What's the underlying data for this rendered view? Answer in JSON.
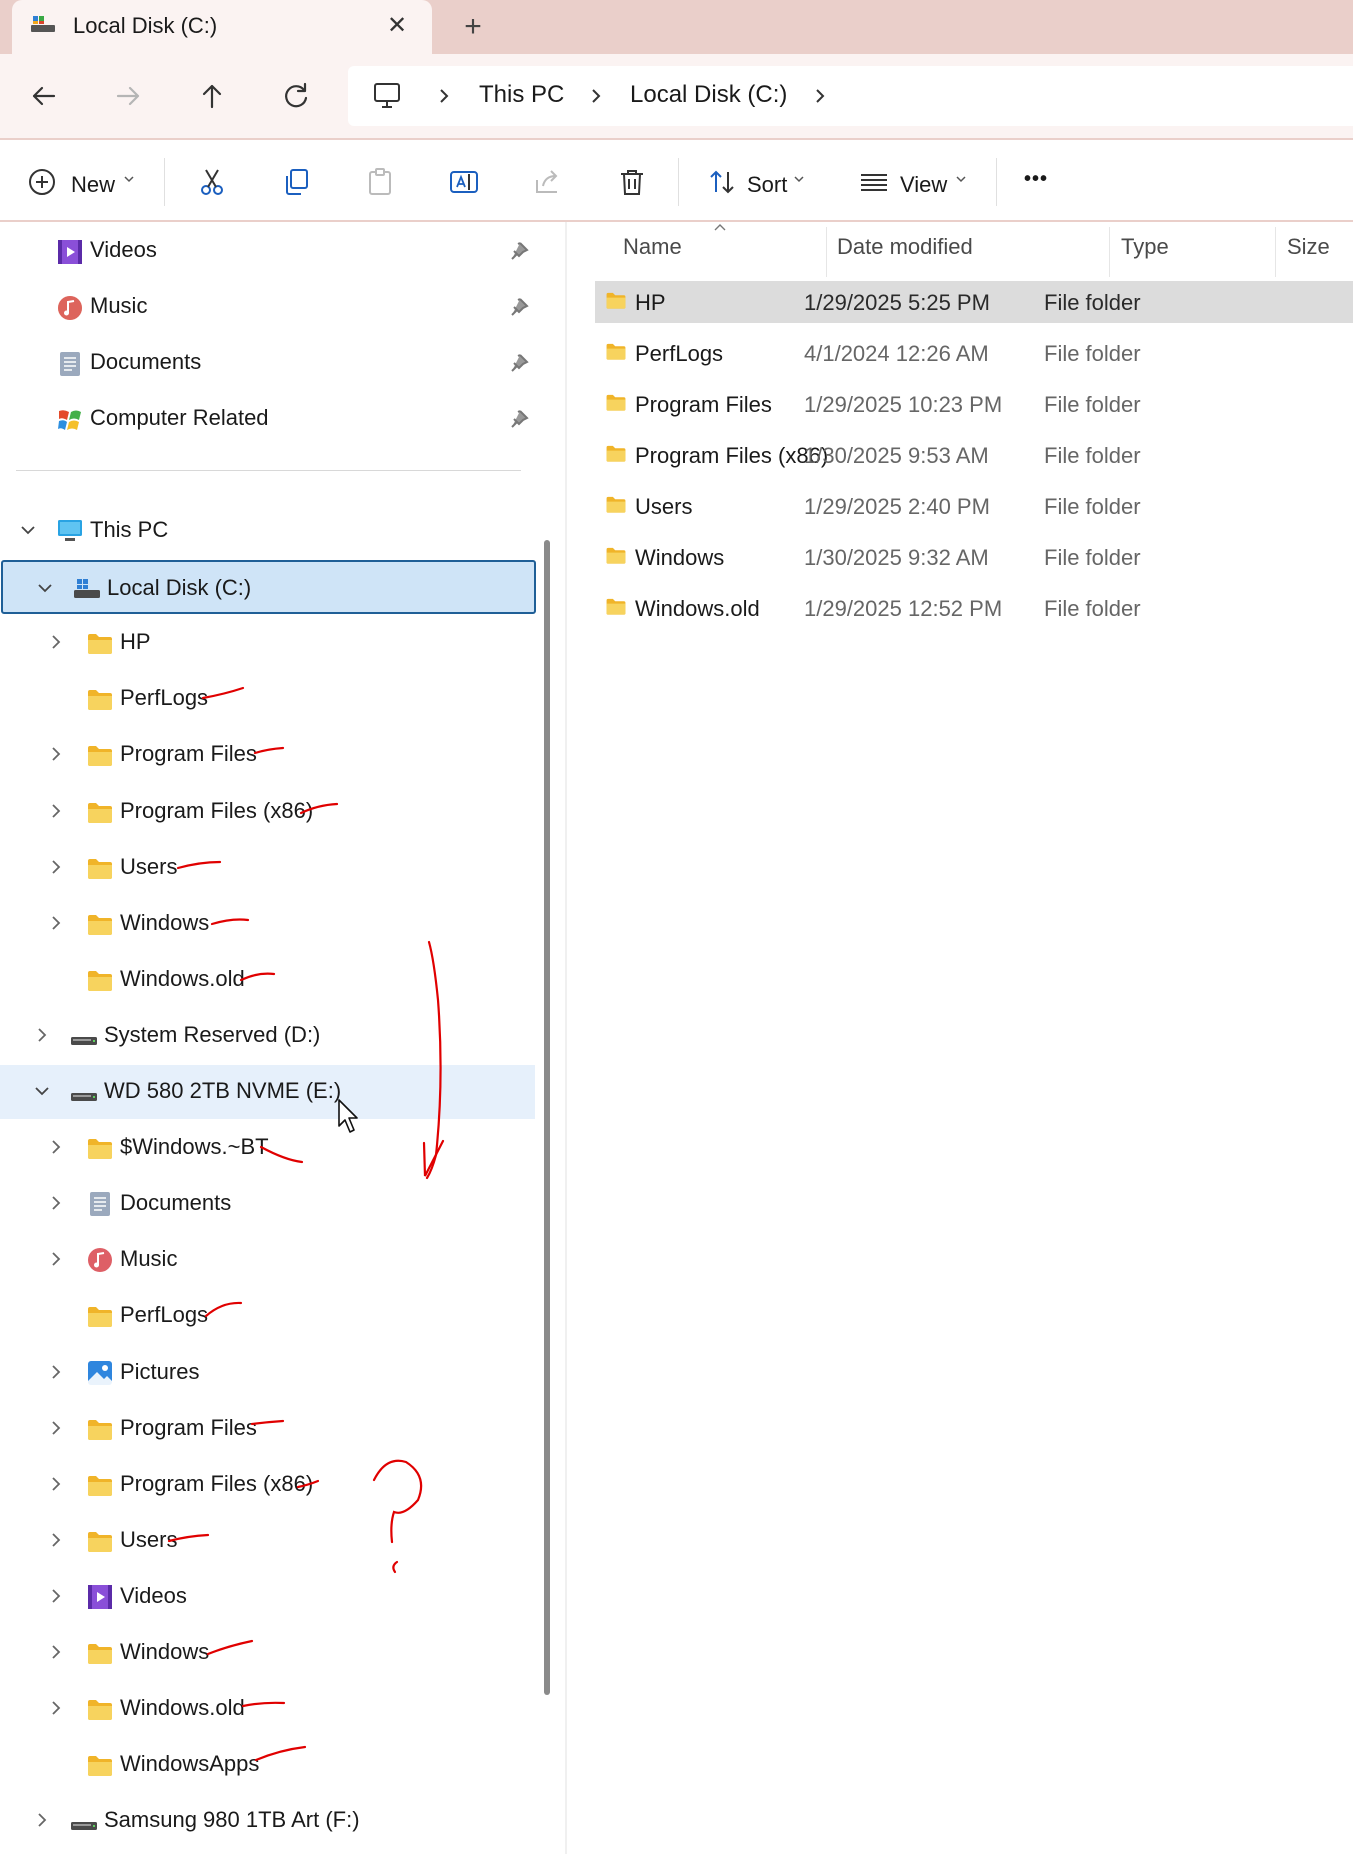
{
  "window": {
    "tab_title": "Local Disk (C:)",
    "close_glyph": "✕",
    "new_tab_glyph": "+"
  },
  "address_bar": {
    "segments": [
      "This PC",
      "Local Disk (C:)"
    ]
  },
  "command_bar": {
    "new_label": "New",
    "sort_label": "Sort",
    "view_label": "View",
    "more_glyph": "•••"
  },
  "sidebar": {
    "quick_access": [
      {
        "label": "Videos",
        "icon": "videos-icon"
      },
      {
        "label": "Music",
        "icon": "music-icon"
      },
      {
        "label": "Documents",
        "icon": "documents-icon"
      },
      {
        "label": "Computer Related",
        "icon": "app-icon"
      }
    ],
    "tree": [
      {
        "label": "This PC",
        "icon": "pc-icon",
        "expanded": true
      },
      {
        "label": "Local Disk (C:)",
        "icon": "drive-icon",
        "expanded": true,
        "selected": true
      },
      {
        "label": "HP",
        "icon": "folder-icon"
      },
      {
        "label": "PerfLogs",
        "icon": "folder-icon"
      },
      {
        "label": "Program Files",
        "icon": "folder-icon"
      },
      {
        "label": "Program Files (x86)",
        "icon": "folder-icon"
      },
      {
        "label": "Users",
        "icon": "folder-icon"
      },
      {
        "label": "Windows",
        "icon": "folder-icon"
      },
      {
        "label": "Windows.old",
        "icon": "folder-icon"
      },
      {
        "label": "System Reserved (D:)",
        "icon": "drive-icon"
      },
      {
        "label": "WD 580 2TB NVME (E:)",
        "icon": "drive-icon",
        "expanded": true
      },
      {
        "label": "$Windows.~BT",
        "icon": "folder-icon"
      },
      {
        "label": "Documents",
        "icon": "documents-icon"
      },
      {
        "label": "Music",
        "icon": "music-icon"
      },
      {
        "label": "PerfLogs",
        "icon": "folder-icon"
      },
      {
        "label": "Pictures",
        "icon": "pictures-icon"
      },
      {
        "label": "Program Files",
        "icon": "folder-icon"
      },
      {
        "label": "Program Files (x86)",
        "icon": "folder-icon"
      },
      {
        "label": "Users",
        "icon": "folder-icon"
      },
      {
        "label": "Videos",
        "icon": "videos-icon"
      },
      {
        "label": "Windows",
        "icon": "folder-icon"
      },
      {
        "label": "Windows.old",
        "icon": "folder-icon"
      },
      {
        "label": "WindowsApps",
        "icon": "folder-icon"
      },
      {
        "label": "Samsung 980 1TB Art (F:)",
        "icon": "drive-icon"
      }
    ]
  },
  "file_list": {
    "columns": [
      "Name",
      "Date modified",
      "Type",
      "Size"
    ],
    "rows": [
      {
        "name": "HP",
        "date": "1/29/2025 5:25 PM",
        "type": "File folder"
      },
      {
        "name": "PerfLogs",
        "date": "4/1/2024 12:26 AM",
        "type": "File folder"
      },
      {
        "name": "Program Files",
        "date": "1/29/2025 10:23 PM",
        "type": "File folder"
      },
      {
        "name": "Program Files (x86)",
        "date": "1/30/2025 9:53 AM",
        "type": "File folder"
      },
      {
        "name": "Users",
        "date": "1/29/2025 2:40 PM",
        "type": "File folder"
      },
      {
        "name": "Windows",
        "date": "1/30/2025 9:32 AM",
        "type": "File folder"
      },
      {
        "name": "Windows.old",
        "date": "1/29/2025 12:52 PM",
        "type": "File folder"
      }
    ]
  },
  "colors": {
    "titlebar": "#eacfca",
    "selection": "#cfe4f7",
    "selection_border": "#1f5f97",
    "annotation": "#e00000",
    "folder": "#f7c948"
  }
}
